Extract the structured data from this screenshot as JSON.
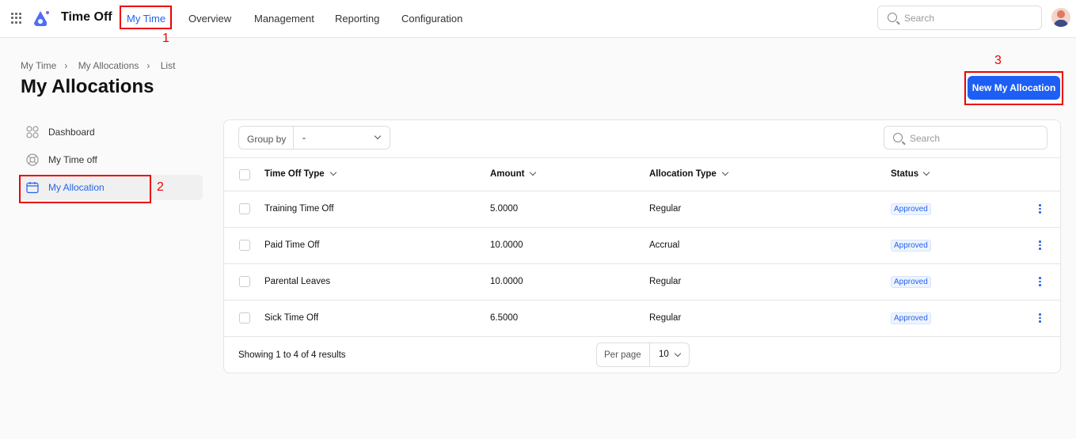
{
  "header": {
    "app_title": "Time Off",
    "nav": [
      "My Time",
      "Overview",
      "Management",
      "Reporting",
      "Configuration"
    ],
    "active_nav": "My Time",
    "search_placeholder": "Search"
  },
  "breadcrumb": [
    "My Time",
    "My Allocations",
    "List"
  ],
  "page_title": "My Allocations",
  "new_button": "New My Allocation",
  "sidebar": [
    {
      "label": "Dashboard",
      "icon": "grid-icon"
    },
    {
      "label": "My Time off",
      "icon": "lifebuoy-icon"
    },
    {
      "label": "My Allocation",
      "icon": "calendar-icon",
      "active": true
    }
  ],
  "toolbar": {
    "group_by_label": "Group by",
    "group_by_value": "-",
    "search_placeholder": "Search"
  },
  "table": {
    "columns": [
      "Time Off Type",
      "Amount",
      "Allocation Type",
      "Status"
    ],
    "rows": [
      {
        "type": "Training Time Off",
        "amount": "5.0000",
        "alloc": "Regular",
        "status": "Approved"
      },
      {
        "type": "Paid Time Off",
        "amount": "10.0000",
        "alloc": "Accrual",
        "status": "Approved"
      },
      {
        "type": "Parental Leaves",
        "amount": "10.0000",
        "alloc": "Regular",
        "status": "Approved"
      },
      {
        "type": "Sick Time Off",
        "amount": "6.5000",
        "alloc": "Regular",
        "status": "Approved"
      }
    ]
  },
  "footer": {
    "showing": "Showing 1 to 4 of 4 results",
    "per_page_label": "Per page",
    "per_page_value": "10"
  },
  "annotations": [
    "1",
    "2",
    "3"
  ],
  "colors": {
    "accent": "#1d5ff5",
    "annotation": "#e00000"
  }
}
